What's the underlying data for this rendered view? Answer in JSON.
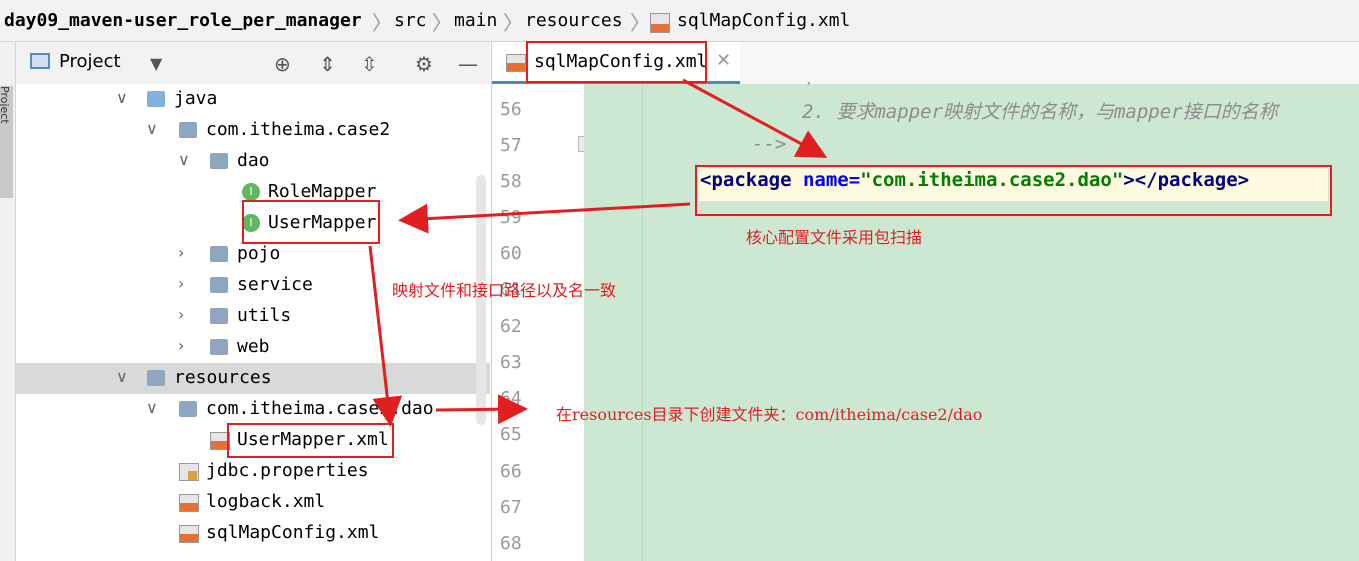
{
  "breadcrumb": {
    "project": "day09_maven-user_role_per_manager",
    "src": "src",
    "main": "main",
    "resources": "resources",
    "file": "sqlMapConfig.xml"
  },
  "tool_strip": {
    "project_tab": "Project"
  },
  "project_panel": {
    "title": "Project",
    "icons": [
      "dropdown-icon",
      "crosshair-icon",
      "expand-all-icon",
      "collapse-all-icon",
      "gear-icon",
      "minimize-icon"
    ]
  },
  "tree": [
    {
      "label": "java",
      "icon": "source-folder-icon",
      "expanded": true
    },
    {
      "label": "com.itheima.case2",
      "icon": "package-icon",
      "expanded": true
    },
    {
      "label": "dao",
      "icon": "package-icon",
      "expanded": true
    },
    {
      "label": "RoleMapper",
      "icon": "interface-icon",
      "badge": "I"
    },
    {
      "label": "UserMapper",
      "icon": "interface-icon",
      "badge": "I"
    },
    {
      "label": "pojo",
      "icon": "package-icon",
      "expanded": false
    },
    {
      "label": "service",
      "icon": "package-icon",
      "expanded": false
    },
    {
      "label": "utils",
      "icon": "package-icon",
      "expanded": false
    },
    {
      "label": "web",
      "icon": "package-icon",
      "expanded": false
    },
    {
      "label": "resources",
      "icon": "resources-folder-icon",
      "expanded": true,
      "selected": true
    },
    {
      "label": "com.itheima.case2.dao",
      "icon": "package-icon",
      "expanded": true
    },
    {
      "label": "UserMapper.xml",
      "icon": "xml-file-icon"
    },
    {
      "label": "jdbc.properties",
      "icon": "properties-file-icon"
    },
    {
      "label": "logback.xml",
      "icon": "xml-file-icon"
    },
    {
      "label": "sqlMapConfig.xml",
      "icon": "xml-file-icon"
    }
  ],
  "editor": {
    "tab_label": "sqlMapConfig.xml",
    "line_numbers": [
      "56",
      "57",
      "58",
      "59",
      "60",
      "61",
      "62",
      "63",
      "64",
      "65",
      "66",
      "67",
      "68"
    ],
    "comment_line": "2. 要求mapper映射文件的名称，与mapper接口的名称",
    "comment_end": "-->",
    "package_line": {
      "open_tag": "<package",
      "attr": " name=",
      "value": "\"com.itheima.case2.dao\"",
      "close": "></package>"
    }
  },
  "annotations": {
    "core_config": "核心配置文件采用包扫描",
    "mapping_note": "映射文件和接口路径以及名一致",
    "create_folder": "在resources目录下创建文件夹：com/itheima/case2/dao"
  },
  "colors": {
    "annotation_red": "#e02020",
    "editor_bg": "#cde8d2",
    "tab_underline": "#4a88c7",
    "xml_tag": "#000080",
    "xml_attr": "#0000ff",
    "xml_value": "#008000"
  }
}
